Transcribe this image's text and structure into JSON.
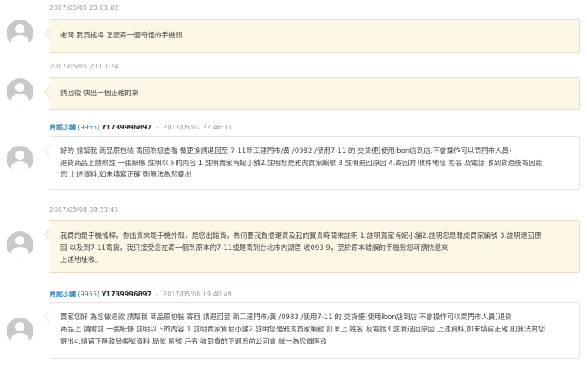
{
  "messages": [
    {
      "type": "buyer",
      "timestamp": "2017/05/05 20:01:02",
      "text": "老闆 我買搖桿 怎麼寄一個奇怪的手機殼"
    },
    {
      "type": "buyer",
      "timestamp": "2017/05/05 20:01:24",
      "text": "請回復 快出一個正確的來"
    },
    {
      "type": "seller",
      "seller_name": "肯妮小舖",
      "seller_count": "(9955)",
      "seller_id": "Y1739996897",
      "separator": "-",
      "timestamp": "2017/05/07 22:46:33",
      "lines": [
        "好的 請幫我 商品原包裝 寄回為您查看 做更換請退回至 7-11新工建門市/黃         /0982                 /使用7-11 的 交貨便(使用ibon店到店,不會操作可以問門市人員)",
        "退貨商品上請附註 一張紙條 註明以下的內容 1.註明賣家肯妮小舖2.註明您是雅虎買家編號 3.註明退回原因 4.寄回的 收件地址 姓名 及電話 收到貨過後寄回給",
        "您 上述資料,如未填寫正確 則無法為您寄出"
      ]
    },
    {
      "type": "buyer",
      "timestamp": "2017/05/08 09:31:41",
      "lines": [
        "我買的是手機搖桿，你出貨來是手機外殼，是您出錯貨，為何要我負擔運費及我的寶貴時間來註明 1.註明賣家肯妮小舖2.註明您是雅虎買家編號 3.註明退回原",
        "因 以及到7-11寄貨，我只接受您在寄一個到原本的7-11或是寄到台北市內湖區                           收093              9，至於原本錯誤的手機殼您可請快遞來",
        "上述地址收。"
      ]
    },
    {
      "type": "seller",
      "seller_name": "肯妮小舖",
      "seller_count": "(9955)",
      "seller_id": "Y1739996897",
      "separator": "-",
      "timestamp": "2017/05/08 19:40:49",
      "lines": [
        "買家您好 為您做退款 請幫我 商品原包裝 寄回 請退回至 新工建門市/黃         /0983                 /使用7-11 的 交貨便(使用ibon店到店,不會操作可以問門市人員)退貨",
        "商品上 請附註 一張紙條 註明以下的內容 1.註明賣家肯尼小舖2.註明您是雅虎買家編號 訂單上 姓名 及電話3.註明退回原因 上述資料,如未填寫正確 則無法為您",
        "寄出4.請留下匯款局帳號資料 局號 帳號 戶名 收到貨的下週五前公司會 統一為您做匯款"
      ]
    }
  ]
}
